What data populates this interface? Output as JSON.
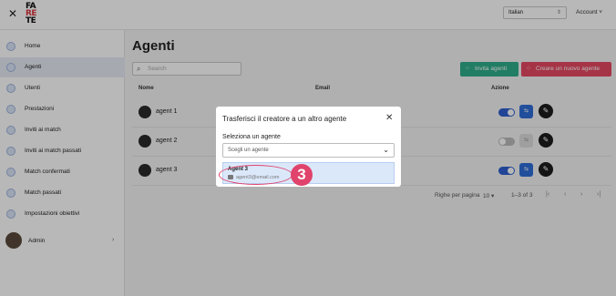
{
  "topbar": {
    "close_icon": "close-icon",
    "logo_lines": [
      "FA",
      "RE"
    ],
    "logo_lines_2": "TE",
    "language": "Italian",
    "account": "Account"
  },
  "sidebar": {
    "items": [
      {
        "label": "Home",
        "icon": "home-icon"
      },
      {
        "label": "Agenti",
        "icon": "user-icon"
      },
      {
        "label": "Utenti",
        "icon": "user-icon"
      },
      {
        "label": "Prestazioni",
        "icon": "list-icon"
      },
      {
        "label": "Inviti ai match",
        "icon": "match-icon"
      },
      {
        "label": "Inviti ai match passati",
        "icon": "match-icon"
      },
      {
        "label": "Match confermati",
        "icon": "match-icon"
      },
      {
        "label": "Match passati",
        "icon": "match-icon"
      },
      {
        "label": "Impostazioni obiettivi",
        "icon": "gear-icon"
      }
    ],
    "admin": "Admin"
  },
  "main": {
    "title": "Agenti",
    "search_placeholder": "Search",
    "invite_button": "Invita agenti",
    "create_button": "Creare un nuovo agente",
    "columns": [
      "Nome",
      "Email",
      "Azione"
    ],
    "rows": [
      {
        "name": "agent 1",
        "active": true
      },
      {
        "name": "agent 2",
        "active": false
      },
      {
        "name": "agent 3",
        "active": true
      }
    ],
    "rows_per_page_label": "Righe per pagina",
    "rows_per_page": "10",
    "range": "1–3 of 3"
  },
  "modal": {
    "title": "Trasferisci il creatore a un altro agente",
    "label": "Seleziona un agente",
    "placeholder": "Scegli un agente",
    "option_name": "Agent 3",
    "option_email": "agent3@email.com"
  },
  "annotation": {
    "step": "3",
    "color": "#e0436b"
  }
}
